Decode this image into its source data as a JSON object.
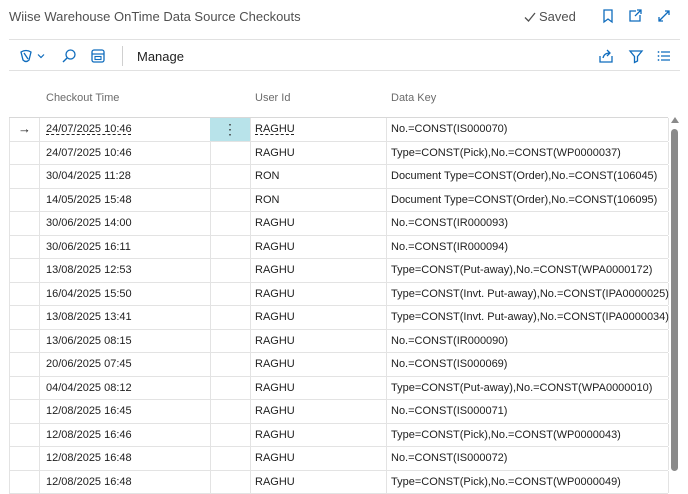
{
  "header": {
    "title": "Wiise Warehouse OnTime Data Source Checkouts",
    "saved_label": "Saved"
  },
  "toolbar": {
    "manage_label": "Manage"
  },
  "columns": {
    "checkout_time": "Checkout Time",
    "user_id": "User Id",
    "data_key": "Data Key"
  },
  "rows": [
    {
      "time": "24/07/2025 10:46",
      "user": "RAGHU",
      "key": "No.=CONST(IS000070)",
      "current": true
    },
    {
      "time": "24/07/2025 10:46",
      "user": "RAGHU",
      "key": "Type=CONST(Pick),No.=CONST(WP0000037)"
    },
    {
      "time": "30/04/2025 11:28",
      "user": "RON",
      "key": "Document Type=CONST(Order),No.=CONST(106045)"
    },
    {
      "time": "14/05/2025 15:48",
      "user": "RON",
      "key": "Document Type=CONST(Order),No.=CONST(106095)"
    },
    {
      "time": "30/06/2025 14:00",
      "user": "RAGHU",
      "key": "No.=CONST(IR000093)"
    },
    {
      "time": "30/06/2025 16:11",
      "user": "RAGHU",
      "key": "No.=CONST(IR000094)"
    },
    {
      "time": "13/08/2025 12:53",
      "user": "RAGHU",
      "key": "Type=CONST(Put-away),No.=CONST(WPA0000172)"
    },
    {
      "time": "16/04/2025 15:50",
      "user": "RAGHU",
      "key": "Type=CONST(Invt. Put-away),No.=CONST(IPA0000025)"
    },
    {
      "time": "13/08/2025 13:41",
      "user": "RAGHU",
      "key": "Type=CONST(Invt. Put-away),No.=CONST(IPA0000034)"
    },
    {
      "time": "13/06/2025 08:15",
      "user": "RAGHU",
      "key": "No.=CONST(IR000090)"
    },
    {
      "time": "20/06/2025 07:45",
      "user": "RAGHU",
      "key": "No.=CONST(IS000069)"
    },
    {
      "time": "04/04/2025 08:12",
      "user": "RAGHU",
      "key": "Type=CONST(Put-away),No.=CONST(WPA0000010)"
    },
    {
      "time": "12/08/2025 16:45",
      "user": "RAGHU",
      "key": "No.=CONST(IS000071)"
    },
    {
      "time": "12/08/2025 16:46",
      "user": "RAGHU",
      "key": "Type=CONST(Pick),No.=CONST(WP0000043)"
    },
    {
      "time": "12/08/2025 16:48",
      "user": "RAGHU",
      "key": "No.=CONST(IS000072)"
    },
    {
      "time": "12/08/2025 16:48",
      "user": "RAGHU",
      "key": "Type=CONST(Pick),No.=CONST(WP0000049)"
    }
  ],
  "current_row_marker": "→",
  "row_menu_glyph": "⋮",
  "colors": {
    "accent": "#0f6cbd",
    "selected_cell": "#b8e3ea"
  },
  "icons": [
    "checkmark-icon",
    "bookmark-icon",
    "open-new-window-icon",
    "expand-icon",
    "copilot-icon",
    "search-icon",
    "edit-list-icon",
    "share-icon",
    "filter-icon",
    "list-view-icon"
  ]
}
